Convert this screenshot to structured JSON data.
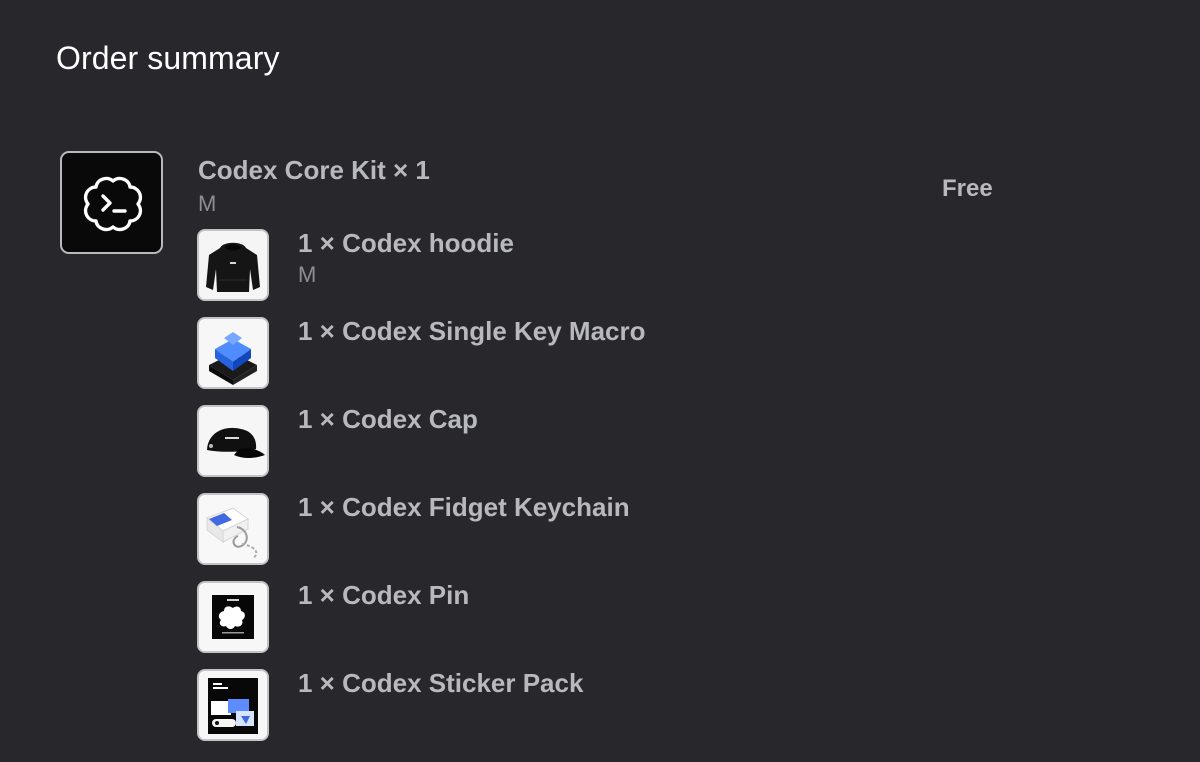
{
  "page_title": "Order summary",
  "kit": {
    "name": "Codex Core Kit × 1",
    "variant": "M",
    "price": "Free",
    "icon": "codex-logo-icon"
  },
  "items": [
    {
      "name": "1 × Codex hoodie",
      "variant": "M",
      "image": "black-hoodie-image"
    },
    {
      "name": "1 × Codex Single Key Macro",
      "variant": "",
      "image": "single-key-macro-image"
    },
    {
      "name": "1 × Codex Cap",
      "variant": "",
      "image": "black-cap-image"
    },
    {
      "name": "1 × Codex Fidget Keychain",
      "variant": "",
      "image": "fidget-keychain-image"
    },
    {
      "name": "1 × Codex Pin",
      "variant": "",
      "image": "pin-image"
    },
    {
      "name": "1 × Codex Sticker Pack",
      "variant": "",
      "image": "sticker-pack-image"
    }
  ],
  "colors": {
    "background": "#27272c",
    "primary_text": "#ffffff",
    "muted_text": "#b8b8bf",
    "variant_text": "#8d8d94",
    "thumbnail_border": "#c2c2c8"
  }
}
